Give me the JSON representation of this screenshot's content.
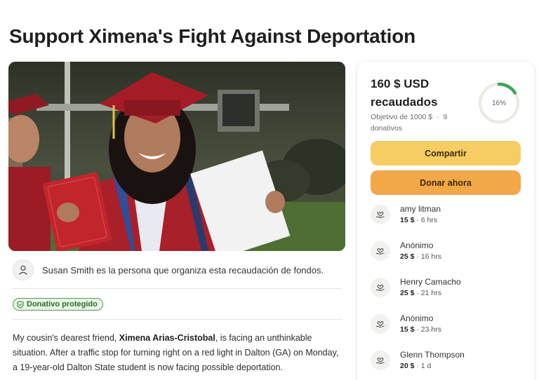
{
  "page": {
    "title": "Support Ximena's Fight Against Deportation"
  },
  "organizer": {
    "text": "Susan Smith es la persona que organiza esta recaudación de fondos."
  },
  "badge": {
    "label": "Donativo protegido"
  },
  "story": {
    "before_name": "My cousin's dearest friend, ",
    "name": "Ximena Arias-Cristobal",
    "after_name": ", is facing an unthinkable situation. After a traffic stop for turning right on a red light in Dalton (GA) on Monday, a 19-year-old Dalton State student is now facing possible deportation."
  },
  "campaign": {
    "raised_amount": "160 $ USD",
    "raised_label": "recaudados",
    "goal_text": "Objetivo de 1000 $",
    "separator": "·",
    "donations_count": "9 donativos",
    "progress_label": "16%",
    "progress_fraction": 0.16,
    "share_label": "Compartir",
    "donate_label": "Donar ahora"
  },
  "donations": [
    {
      "name": "amy litman",
      "amount": "15 $",
      "time": "· 6 hrs"
    },
    {
      "name": "Anónimo",
      "amount": "25 $",
      "time": "· 16 hrs"
    },
    {
      "name": "Henry Camacho",
      "amount": "25 $",
      "time": "· 21 hrs"
    },
    {
      "name": "Anónimo",
      "amount": "15 $",
      "time": "· 23 hrs"
    },
    {
      "name": "Glenn Thompson",
      "amount": "20 $",
      "time": "· 1 d"
    }
  ],
  "colors": {
    "progress": "#3aa655",
    "progress_track": "#eceae4",
    "share": "#f6cd62",
    "donate": "#f2a748",
    "badge_border": "#4f9d58"
  }
}
